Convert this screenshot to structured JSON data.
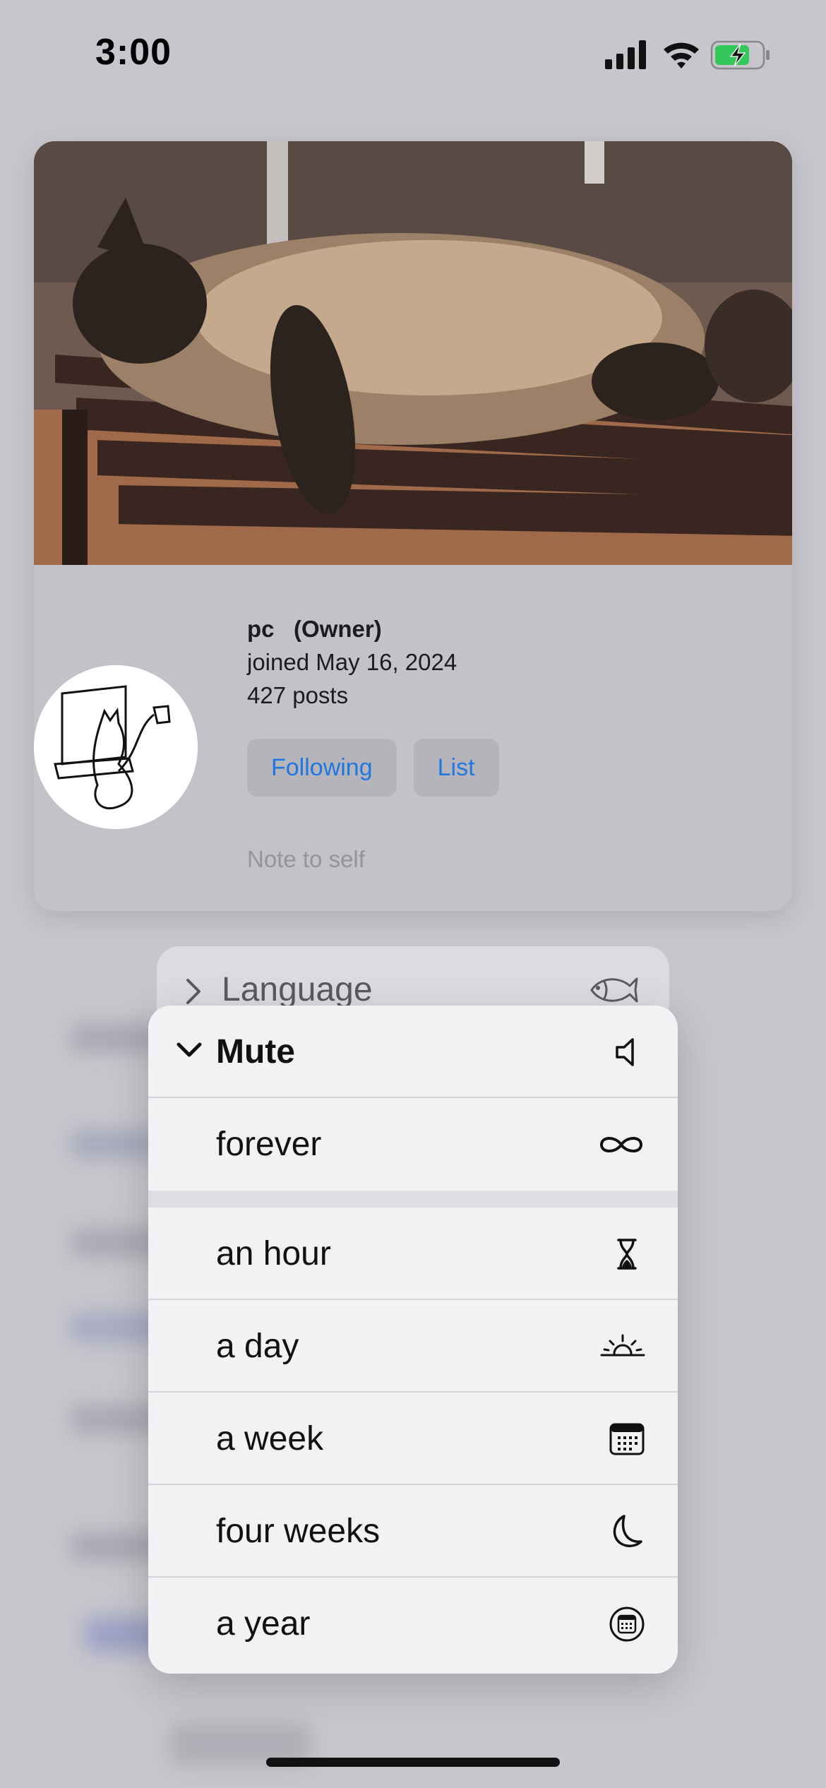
{
  "status_bar": {
    "time": "3:00"
  },
  "profile": {
    "name": "pc",
    "role": "(Owner)",
    "joined": "joined May 16, 2024",
    "posts": "427 posts",
    "following_button": "Following",
    "list_button": "List",
    "note_placeholder": "Note to self"
  },
  "language_menu": {
    "label": "Language",
    "icon": "fish-icon"
  },
  "mute_menu": {
    "title": "Mute",
    "title_icon": "speaker-icon",
    "items": [
      {
        "label": "forever",
        "icon": "infinity-icon"
      },
      {
        "label": "an hour",
        "icon": "hourglass-icon"
      },
      {
        "label": "a day",
        "icon": "sunrise-icon"
      },
      {
        "label": "a week",
        "icon": "calendar-icon"
      },
      {
        "label": "four weeks",
        "icon": "moon-icon"
      },
      {
        "label": "a year",
        "icon": "calendar-circle-icon"
      }
    ]
  },
  "colors": {
    "accent": "#1f78e0",
    "battery_fill": "#34c759",
    "backdrop": "#c7c6cd"
  }
}
